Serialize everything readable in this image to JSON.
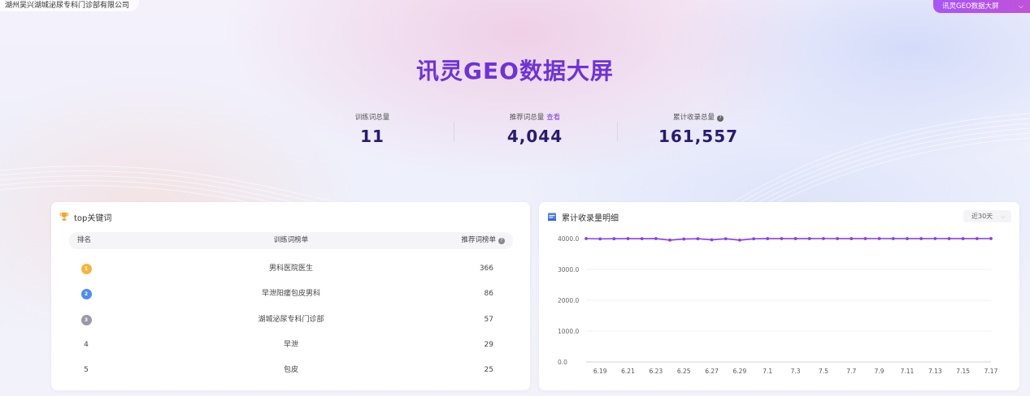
{
  "header": {
    "company": "湖州吴兴湖城泌尿专科门诊部有限公司",
    "screen_select": "讯灵GEO数据大屏",
    "title": "讯灵GEO数据大屏"
  },
  "stats": [
    {
      "label": "训练词总量",
      "value": "11"
    },
    {
      "label": "推荐词总量",
      "link": "查看",
      "value": "4,044"
    },
    {
      "label": "累计收录总量",
      "value": "161,557"
    }
  ],
  "keywords": {
    "title": "top关键词",
    "columns": {
      "rank": "排名",
      "keyword": "训练词榜单",
      "count": "推荐词榜单"
    },
    "rows": [
      {
        "rank": "1",
        "keyword": "男科医院医生",
        "count": "366"
      },
      {
        "rank": "2",
        "keyword": "早泄阳痿包皮男科",
        "count": "86"
      },
      {
        "rank": "3",
        "keyword": "湖城泌尿专科门诊部",
        "count": "57"
      },
      {
        "rank": "4",
        "keyword": "早泄",
        "count": "29"
      },
      {
        "rank": "5",
        "keyword": "包皮",
        "count": "25"
      }
    ],
    "medal_colors": [
      "#f4b63a",
      "#4a8ff0",
      "#9a9aa6"
    ]
  },
  "detail": {
    "title": "累计收录量明细",
    "range": "近30天"
  },
  "chart_data": {
    "type": "line",
    "x": [
      "6.18",
      "6.19",
      "6.20",
      "6.21",
      "6.22",
      "6.23",
      "6.24",
      "6.25",
      "6.26",
      "6.27",
      "6.28",
      "6.29",
      "6.30",
      "7.1",
      "7.2",
      "7.3",
      "7.4",
      "7.5",
      "7.6",
      "7.7",
      "7.8",
      "7.9",
      "7.10",
      "7.11",
      "7.12",
      "7.13",
      "7.14",
      "7.15",
      "7.16",
      "7.17"
    ],
    "x_tick_labels": [
      "6.19",
      "6.21",
      "6.23",
      "6.25",
      "6.27",
      "6.29",
      "7.1",
      "7.3",
      "7.5",
      "7.7",
      "7.9",
      "7.11",
      "7.13",
      "7.15",
      "7.17"
    ],
    "series": [
      {
        "values": [
          4000,
          3990,
          3995,
          3998,
          3996,
          3999,
          3950,
          3985,
          3995,
          3960,
          3994,
          3950,
          3992,
          3998,
          3999,
          3998,
          3999,
          4000,
          3999,
          3998,
          3999,
          4000,
          3999,
          3998,
          3999,
          4000,
          3999,
          3998,
          3999,
          4000
        ],
        "color": "#8b3fe3"
      }
    ],
    "y_ticks": [
      "0.0",
      "1000.0",
      "2000.0",
      "3000.0",
      "4000.0"
    ],
    "ylim": [
      0,
      4000
    ],
    "grid": true
  }
}
